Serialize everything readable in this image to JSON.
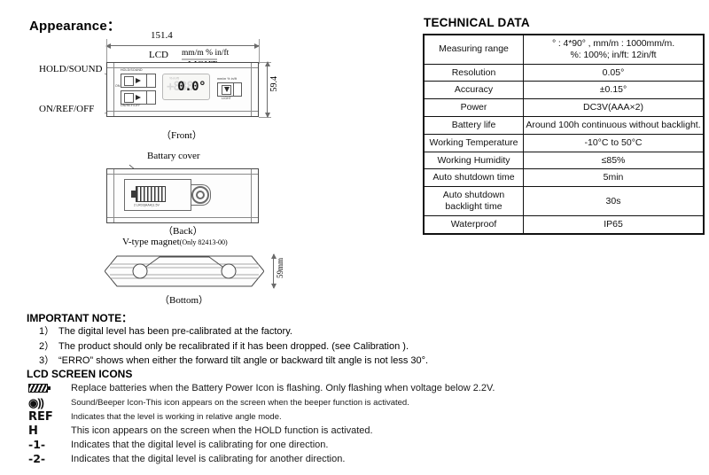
{
  "left": {
    "appearance_title": "Appearance：",
    "front": {
      "width_dim": "151.4",
      "height_dim": "59.4",
      "caption": "（Front）",
      "label_hold": "HOLD/SOUND",
      "label_onref": "ON/REF/OFF",
      "label_lcd": "LCD",
      "label_units": "mm/m % in/ft",
      "label_light": "LIGHT",
      "lcd_ghost": "+888",
      "lcd_value": "0.0°",
      "lcd_units_row": "% in/ft",
      "btn_micro_hold": "HOLD/SOUND",
      "btn_micro_onref": "ON/REF/OFF",
      "btn_micro_on": "ON",
      "btn_micro_mode": "mm/m % in/ft",
      "btn_micro_light": "LIGHT"
    },
    "back": {
      "caption": "（Back）",
      "label_battery_cover": "Battary cover",
      "battery_micro": "2 LR03(AAA)1.5V"
    },
    "bottom": {
      "caption": "（Bottom）",
      "label_magnet": "V-type magnet",
      "label_magnet_sub": "(Only  82413-00)",
      "height_dim": "59mm"
    }
  },
  "tech": {
    "title": "TECHNICAL DATA",
    "rows": [
      {
        "key": "Measuring range",
        "value": "°  :  4*90°  , mm/m  :  1000mm/m.\n%:  100%;  in/ft:  12in/ft",
        "tight": true
      },
      {
        "key": "Resolution",
        "value": "0.05°",
        "tight": false
      },
      {
        "key": "Accuracy",
        "value": "±0.15°",
        "tight": false
      },
      {
        "key": "Power",
        "value": "DC3V(AAA×2)",
        "tight": false
      },
      {
        "key": "Battery life",
        "value": "Around 100h continuous without backlight.",
        "tight": false
      },
      {
        "key": "Working Temperature",
        "value": "-10°C to 50°C",
        "tight": false
      },
      {
        "key": "Working Humidity",
        "value": "≤85%",
        "tight": false
      },
      {
        "key": "Auto shutdown time",
        "value": "5min",
        "tight": false
      },
      {
        "key": "Auto shutdown backlight time",
        "value": "30s",
        "tight": false
      },
      {
        "key": "Waterproof",
        "value": "IP65",
        "tight": false
      }
    ]
  },
  "notes": {
    "title": "IMPORTANT NOTE：",
    "items": [
      {
        "num": "1）",
        "text": "The digital level has been pre-calibrated at the factory."
      },
      {
        "num": "2）",
        "text": "The product should only be recalibrated if it has been dropped. (see Calibration )."
      },
      {
        "num": "3）",
        "text": "“ERRO” shows when either the forward tilt angle or backward tilt angle is not less 30°."
      }
    ]
  },
  "lcd_icons": {
    "title": "LCD SCREEN ICONS",
    "items": [
      {
        "icon": "battery-icon",
        "glyph": "",
        "text": "Replace batteries when the Battery Power Icon is flashing. Only flashing when voltage below 2.2V.",
        "small": false
      },
      {
        "icon": "sound-beeper-icon",
        "glyph": "◉))",
        "text": "Sound/Beeper Icon-This icon appears on the screen when the beeper function is activated.",
        "small": true
      },
      {
        "icon": "ref-icon",
        "glyph": "REF",
        "text": "Indicates that the level is working in relative angle mode.",
        "small": true
      },
      {
        "icon": "hold-icon",
        "glyph": "H",
        "text": "This icon appears on the screen when the HOLD function is activated.",
        "small": false
      },
      {
        "icon": "calibration-direction-1-icon",
        "glyph": "-1-",
        "text": "Indicates that the digital level is calibrating for one direction.",
        "small": false
      },
      {
        "icon": "calibration-direction-2-icon",
        "glyph": "-2-",
        "text": "Indicates that the digital level is calibrating for another direction.",
        "small": false
      }
    ]
  }
}
